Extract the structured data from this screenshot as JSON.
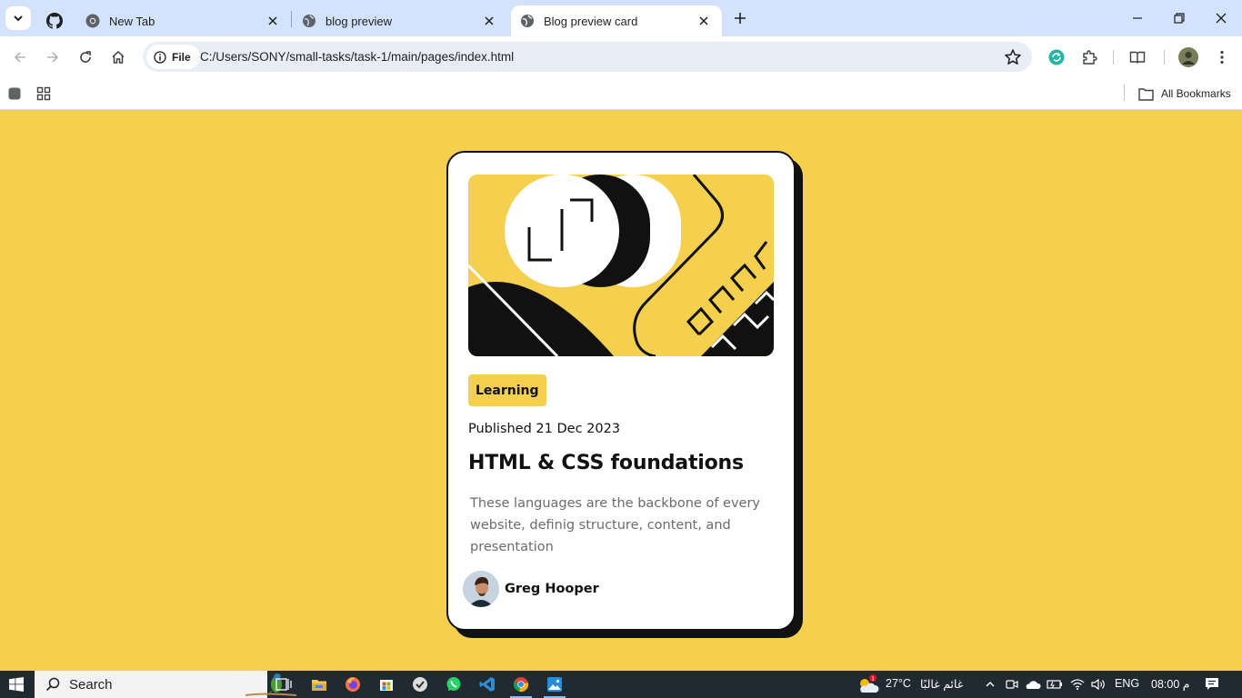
{
  "browser": {
    "tabs": [
      {
        "title": "",
        "icon": "github-icon"
      },
      {
        "title": "New Tab",
        "icon": "chrome-icon"
      },
      {
        "title": "blog preview",
        "icon": "globe-icon"
      },
      {
        "title": "Blog preview card",
        "icon": "globe-icon",
        "active": true
      }
    ],
    "site_chip": "File",
    "url": "C:/Users/SONY/small-tasks/task-1/main/pages/index.html",
    "bookmarks_label": "All Bookmarks"
  },
  "card": {
    "tag": "Learning",
    "published": "Published 21 Dec 2023",
    "title": "HTML & CSS foundations",
    "description": "These languages are the backbone of every website, definig structure, content, and presentation",
    "author": "Greg Hooper"
  },
  "taskbar": {
    "search_label": "Search",
    "weather_badge": "1",
    "temperature": "27°C",
    "weather_text": "غائم غالبًا",
    "language": "ENG",
    "clock": "08:00 م"
  },
  "colors": {
    "page_background": "#f4d04e",
    "card_border": "#111111",
    "tab_strip": "#d3e3fd",
    "taskbar": "#202a30"
  }
}
